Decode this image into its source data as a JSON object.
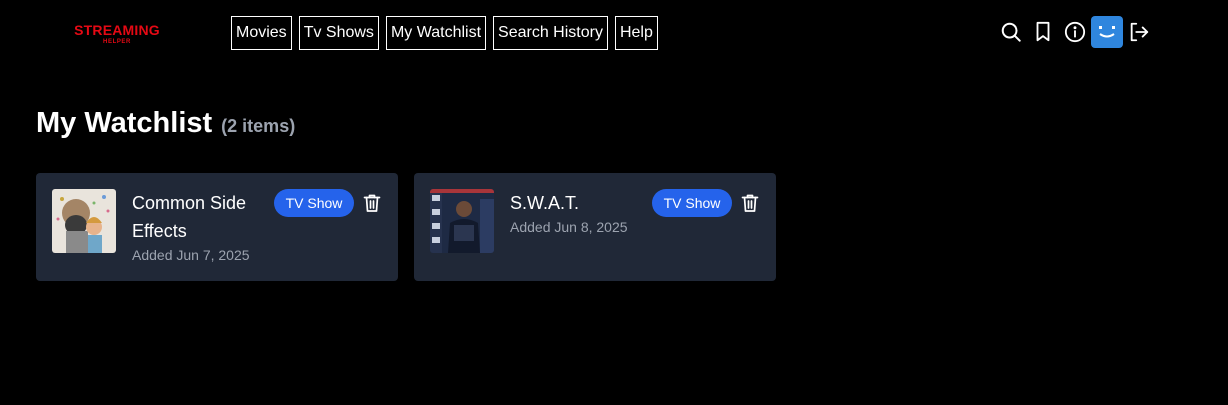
{
  "brand": {
    "name": "STREAMING",
    "sub": "HELPER",
    "color": "#e50914"
  },
  "nav": [
    {
      "label": "Movies"
    },
    {
      "label": "Tv Shows"
    },
    {
      "label": "My Watchlist"
    },
    {
      "label": "Search History"
    },
    {
      "label": "Help"
    }
  ],
  "header_icons": [
    "search-icon",
    "bookmark-icon",
    "info-icon",
    "profile-avatar",
    "logout-icon"
  ],
  "page": {
    "title": "My Watchlist",
    "count": "(2 items)"
  },
  "items": [
    {
      "title": "Common Side Effects",
      "added": "Added Jun 7, 2025",
      "badge": "TV Show"
    },
    {
      "title": "S.W.A.T.",
      "added": "Added Jun 8, 2025",
      "badge": "TV Show"
    }
  ],
  "colors": {
    "accent": "#2563eb",
    "card": "#202837",
    "muted": "#9ca3af",
    "avatar": "#2f86de"
  }
}
